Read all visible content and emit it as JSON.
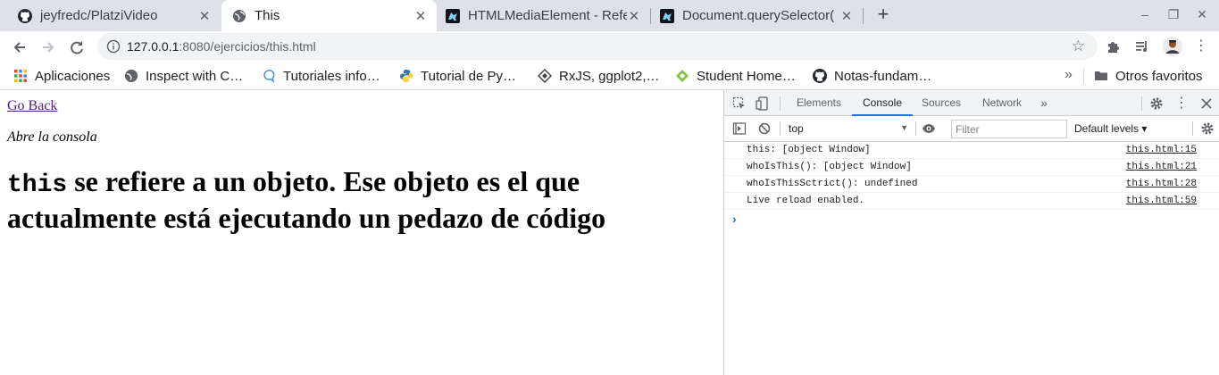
{
  "tabs": [
    {
      "title": "jeyfredc/PlatziVideo",
      "icon": "github-icon"
    },
    {
      "title": "This",
      "icon": "globe-icon"
    },
    {
      "title": "HTMLMediaElement - Refe",
      "icon": "mdn-dino-icon"
    },
    {
      "title": "Document.querySelector(",
      "icon": "mdn-dino-icon"
    }
  ],
  "tab_close": "✕",
  "new_tab": "+",
  "window_controls": {
    "minimize": "–",
    "restore": "❐",
    "close": "✕"
  },
  "address": {
    "host": "127.0.0.1",
    "rest": ":8080/ejercicios/this.html"
  },
  "bookmarks": [
    {
      "label": "Aplicaciones",
      "icon": "apps-grid-icon"
    },
    {
      "label": "Inspect with C…",
      "icon": "globe-icon"
    },
    {
      "label": "Tutoriales info…",
      "icon": "speech-bubble-icon"
    },
    {
      "label": "Tutorial de Py…",
      "icon": "python-icon"
    },
    {
      "label": "RxJS, ggplot2,…",
      "icon": "diamond-icon"
    },
    {
      "label": "Student Home…",
      "icon": "green-diamond-icon"
    },
    {
      "label": "Notas-fundam…",
      "icon": "github-icon"
    }
  ],
  "bookmarks_more": "»",
  "other_bookmarks": "Otros favoritos",
  "page": {
    "back_link": "Go Back",
    "hint": "Abre la consola",
    "heading_code": "this",
    "heading_rest": " se refiere a un objeto. Ese objeto es el que actualmente está ejecutando un pedazo de código"
  },
  "devtools": {
    "tabs": [
      "Elements",
      "Console",
      "Sources",
      "Network"
    ],
    "active_tab": "Console",
    "more_tabs": "»",
    "context": "top",
    "filter_placeholder": "Filter",
    "levels": "Default levels ▾",
    "console_rows": [
      {
        "message": "this: [object Window]",
        "source": "this.html:15"
      },
      {
        "message": "whoIsThis(): [object Window]",
        "source": "this.html:21"
      },
      {
        "message": "whoIsThisSctrict(): undefined",
        "source": "this.html:28"
      },
      {
        "message": "Live reload enabled.",
        "source": "this.html:59"
      }
    ],
    "prompt": "›"
  }
}
